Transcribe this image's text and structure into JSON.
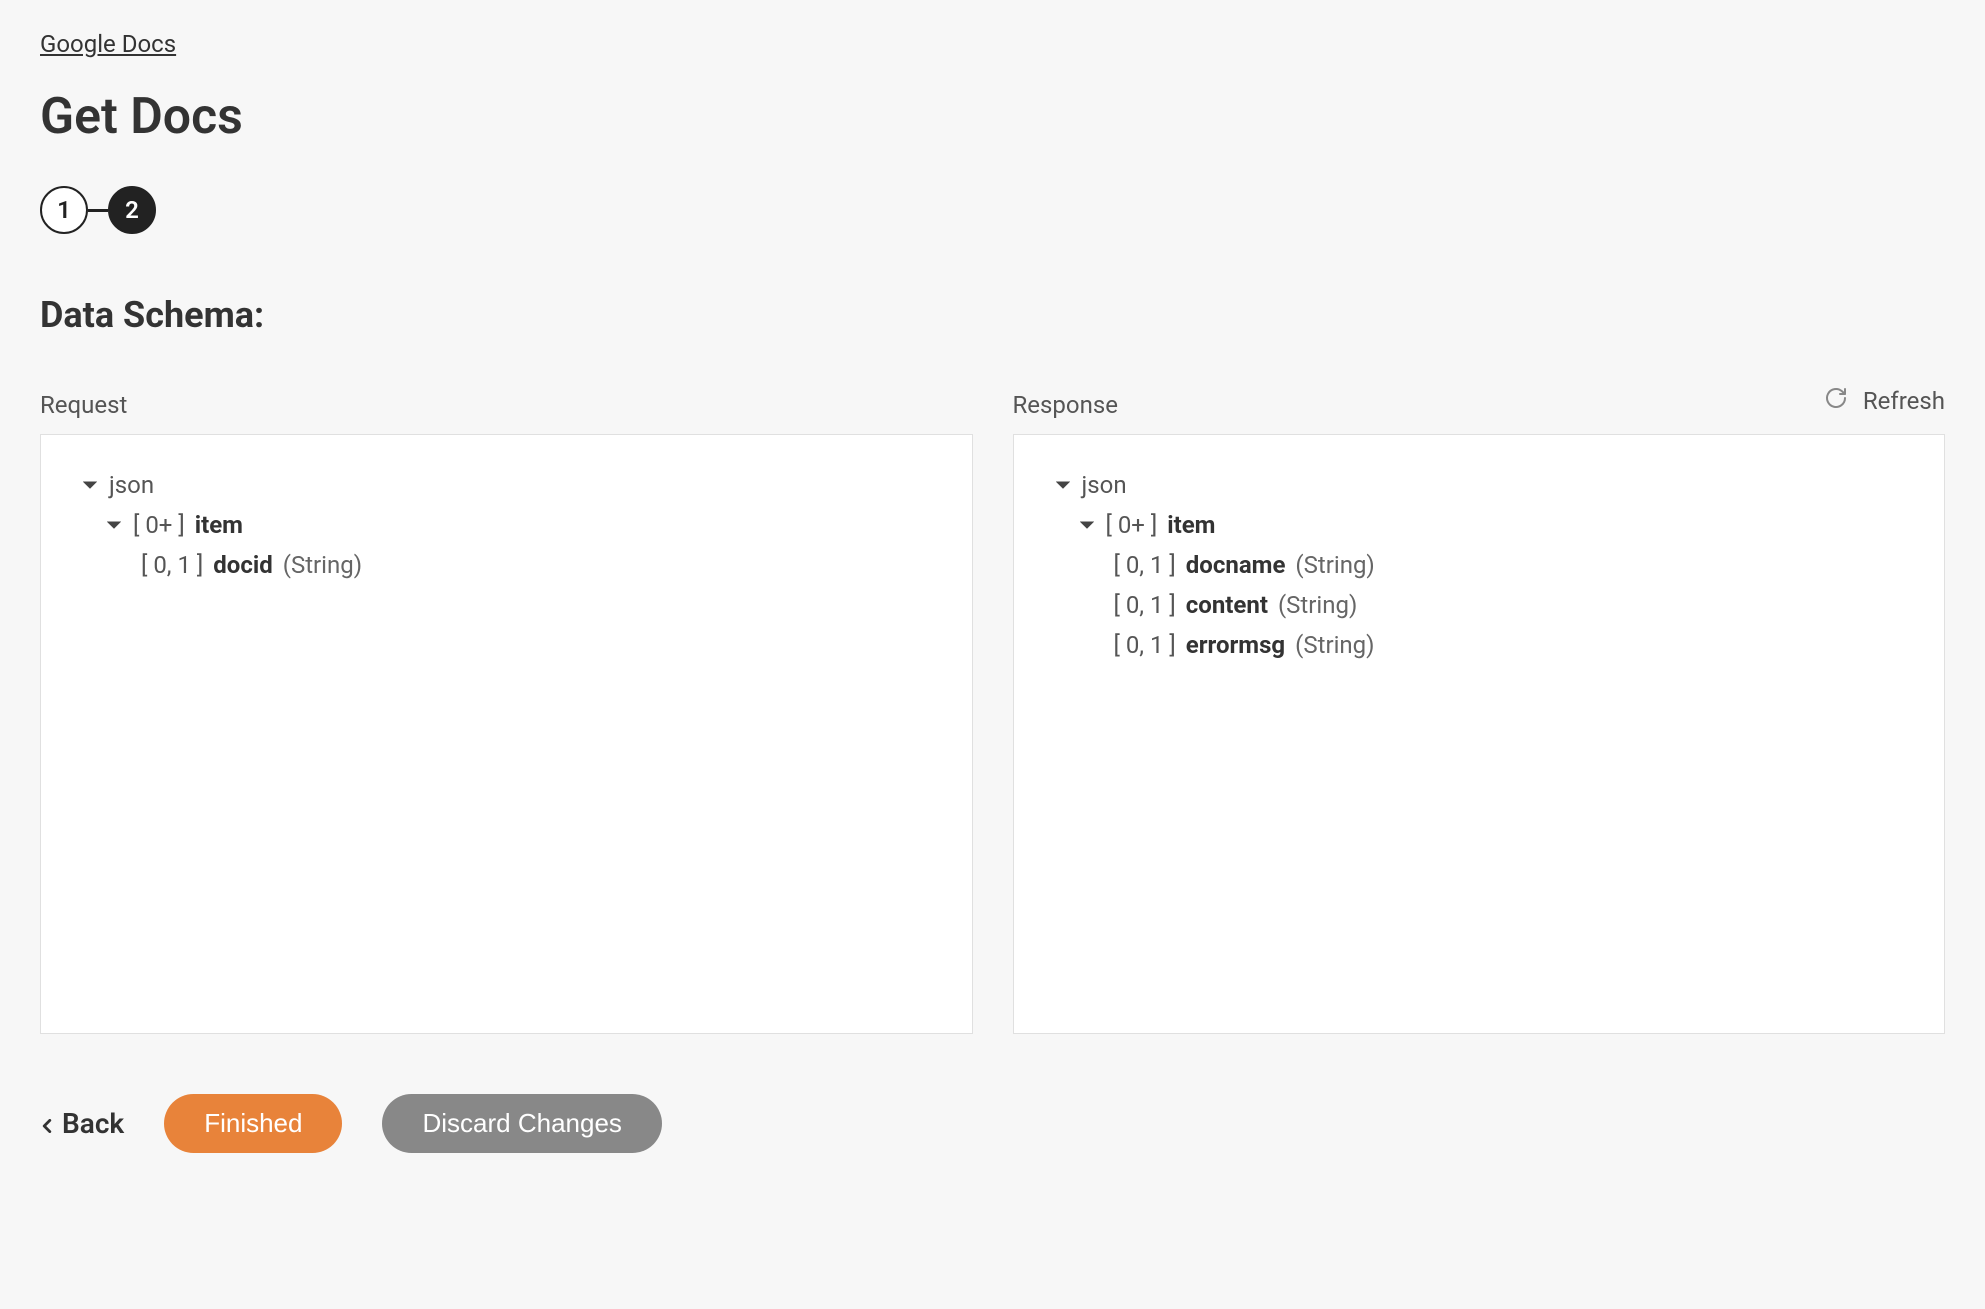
{
  "breadcrumb": "Google Docs",
  "title": "Get Docs",
  "stepper": {
    "step1": "1",
    "step2": "2"
  },
  "section_title": "Data Schema:",
  "refresh_label": "Refresh",
  "request": {
    "label": "Request",
    "root": "json",
    "item_prefix": "[ 0+ ] ",
    "item_name": "item",
    "fields": [
      {
        "cardinality": "[ 0, 1 ] ",
        "name": "docid",
        "type": " (String)"
      }
    ]
  },
  "response": {
    "label": "Response",
    "root": "json",
    "item_prefix": "[ 0+ ] ",
    "item_name": "item",
    "fields": [
      {
        "cardinality": "[ 0, 1 ] ",
        "name": "docname",
        "type": " (String)"
      },
      {
        "cardinality": "[ 0, 1 ] ",
        "name": "content",
        "type": " (String)"
      },
      {
        "cardinality": "[ 0, 1 ] ",
        "name": "errormsg",
        "type": " (String)"
      }
    ]
  },
  "footer": {
    "back": "Back",
    "finished": "Finished",
    "discard": "Discard Changes"
  }
}
